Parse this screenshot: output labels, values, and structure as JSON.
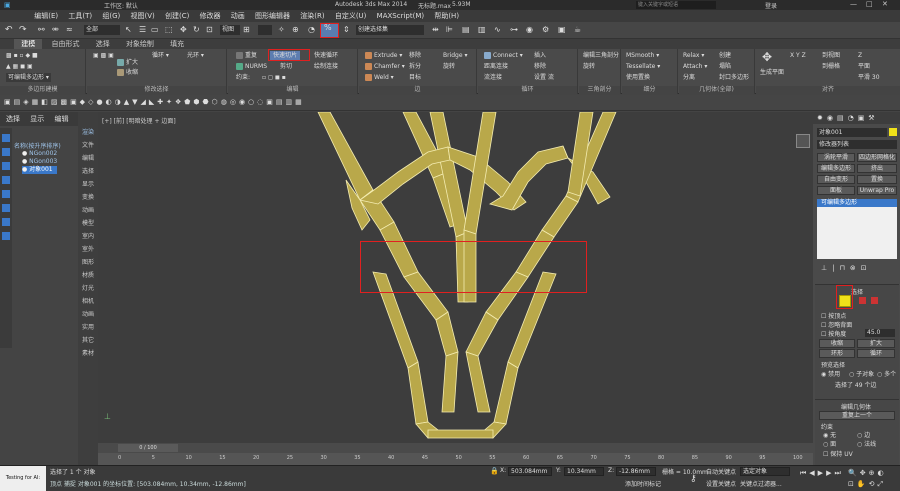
{
  "title": {
    "app": "Autodesk 3ds Max 2014",
    "file": "无标题.max",
    "mem": "5.93M",
    "workspace": "工作区: 默认",
    "search_placeholder": "键入关键字或短语",
    "login": "登录"
  },
  "menubar": [
    "编辑(E)",
    "工具(T)",
    "组(G)",
    "视图(V)",
    "创建(C)",
    "修改器",
    "动画",
    "图形编辑器",
    "渲染(R)",
    "自定义(U)",
    "MAXScript(M)",
    "帮助(H)"
  ],
  "qat": {
    "selection_filter": "全部",
    "named_set": "创建选择集",
    "view": "视图"
  },
  "ribbon_tabs": [
    "建模",
    "自由形式",
    "选择",
    "对象绘制",
    "填充"
  ],
  "ribbon": {
    "poly_modeling": "多边形建模",
    "modify_selection": "修改选择",
    "edit": "编辑",
    "geometry": "几何体(全部)",
    "edges": "边",
    "loops": "循环",
    "tris": "三角剖分",
    "subdivision": "细分",
    "align": "对齐",
    "grow": "扩大",
    "shrink": "收缩",
    "loop": "循环",
    "ring": "光环",
    "repeat": "重复",
    "quickslice": "快速切片",
    "quickloop": "快速循环",
    "nurms": "NURMS",
    "cut": "剪切",
    "swiftloop": "绘制连接",
    "constraints": "约束:",
    "extrude": "Extrude",
    "chamfer": "Chamfer",
    "weld": "Weld",
    "remove": "移除",
    "split": "拆分",
    "target": "目标",
    "bridge": "Bridge",
    "spin": "旋转",
    "connect": "Connect",
    "distance_connect": "距离连接",
    "flow_connect": "流连接",
    "insert": "插入",
    "remove2": "移除",
    "settings": "设置",
    "flow": "流",
    "edit_tris": "编辑三角剖分",
    "rotate": "旋转",
    "msmooth": "MSmooth",
    "tessellate": "Tessellate",
    "use_displacement": "使用置换",
    "relax": "Relax",
    "attach": "Attach",
    "collapse": "塌陷",
    "detach": "分离",
    "create": "创建",
    "cap_poly": "封口多边形",
    "generate_planar": "生成平面",
    "to_view": "到视图",
    "to_grid": "到栅格",
    "x": "X",
    "y": "Y",
    "z": "Z",
    "planar": "平面",
    "smooth30": "平滑 30"
  },
  "scene_explorer": {
    "tabs": [
      "选择",
      "显示",
      "编辑"
    ],
    "header": "名称(按升序排序)",
    "items": [
      "NGon002",
      "NGon003",
      "对象001"
    ]
  },
  "viewport_label": "[+] [前] [明暗处理 + 边面]",
  "viewport_side": [
    "渲染",
    "文件",
    "编辑",
    "选择",
    "显示",
    "变换",
    "动画",
    "模型",
    "室内",
    "室外",
    "图形",
    "材质",
    "灯光",
    "相机",
    "动画",
    "实用",
    "其它",
    "素材"
  ],
  "timeline": {
    "frame": "0 / 100",
    "ticks": [
      "0",
      "5",
      "10",
      "15",
      "20",
      "25",
      "30",
      "35",
      "40",
      "45",
      "50",
      "55",
      "60",
      "65",
      "70",
      "75",
      "80",
      "85",
      "90",
      "95",
      "100"
    ]
  },
  "cmdpanel": {
    "object_name": "对象001",
    "modifier_list": "修改器列表",
    "mods": [
      "涡轮平滑",
      "四边形网格化",
      "编辑多边形",
      "挤出",
      "自由变形",
      "置换",
      "面板",
      "Unwrap Pro"
    ],
    "stack_item": "可编辑多边形",
    "selection_title": "选择",
    "by_vertex": "按顶点",
    "ignore_backfacing": "忽略背面",
    "by_angle": "按角度",
    "angle": "45.0",
    "shrink": "收缩",
    "grow": "扩大",
    "ring": "环形",
    "loop": "循环",
    "preview": "预览选择",
    "disabled": "禁用",
    "subobj": "子对象",
    "multi": "多个",
    "selected": "选择了 49 个边",
    "edit_geometry": "编辑几何体",
    "repeat_last": "重复上一个",
    "constraints": "约束",
    "none": "无",
    "edge": "边",
    "face": "面",
    "normal": "法线",
    "preserve_uvs": "保持 UV"
  },
  "status": {
    "tag": "Testing for AI:",
    "selected": "选择了 1 个 对象",
    "prompt": "顶点 捕捉 对象001 的坐标位置: [503.084mm, 10.34mm, -12.86mm]",
    "x": "503.084mm",
    "y": "10.34mm",
    "z": "-12.86mm",
    "grid": "栅格 = 10.0mm",
    "autokey": "自动关键点",
    "selected_obj": "选定对象",
    "setkey": "设置关键点",
    "keyfilter": "关键点过滤器...",
    "add_time_tag": "添加时间标记"
  },
  "colors": {
    "mesh_fill": "#b9a84a",
    "mesh_edge": "#f4ecb0",
    "accent_blue": "#3a78c9",
    "highlight": "#e02020",
    "yellow": "#f0e21a"
  }
}
